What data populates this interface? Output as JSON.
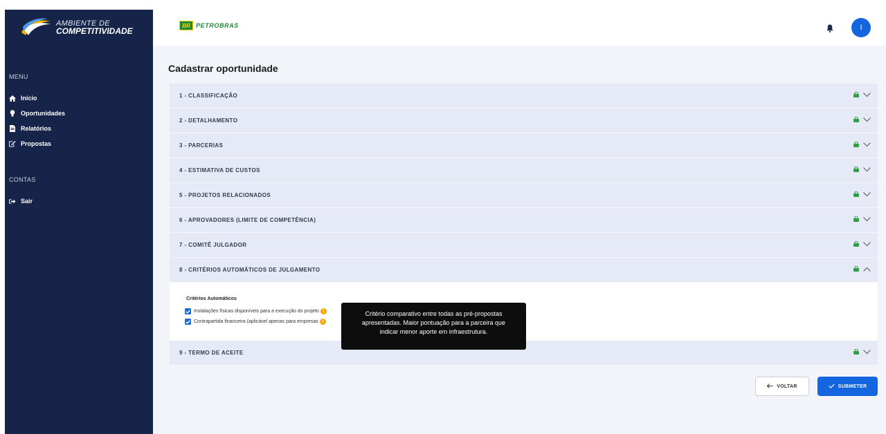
{
  "sidebar": {
    "logo": {
      "line1": "AMBIENTE DE",
      "line2": "COMPETITIVIDADE"
    },
    "menu_heading": "MENU",
    "menu_items": [
      {
        "label": "Início",
        "icon": "home-icon"
      },
      {
        "label": "Oportunidades",
        "icon": "lightbulb-icon"
      },
      {
        "label": "Relatórios",
        "icon": "file-icon"
      },
      {
        "label": "Propostas",
        "icon": "edit-icon"
      }
    ],
    "accounts_heading": "CONTAS",
    "account_items": [
      {
        "label": "Sair",
        "icon": "sign-out-icon"
      }
    ]
  },
  "header": {
    "brand_badge": "BR",
    "brand_name": "PETROBRAS",
    "avatar_initial": "I"
  },
  "main": {
    "title": "Cadastrar oportunidade",
    "sections": [
      {
        "label": "1 - CLASSIFICAÇÃO",
        "expanded": false
      },
      {
        "label": "2 - DETALHAMENTO",
        "expanded": false
      },
      {
        "label": "3 - PARCERIAS",
        "expanded": false
      },
      {
        "label": "4 - ESTIMATIVA DE CUSTOS",
        "expanded": false
      },
      {
        "label": "5 - PROJETOS RELACIONADOS",
        "expanded": false
      },
      {
        "label": "6 - APROVADORES (LIMITE DE COMPETÊNCIA)",
        "expanded": false
      },
      {
        "label": "7 - COMITÊ JULGADOR",
        "expanded": false
      },
      {
        "label": "8 - CRITÉRIOS AUTOMÁTICOS DE JULGAMENTO",
        "expanded": true
      },
      {
        "label": "9 - TERMO DE ACEITE",
        "expanded": false
      }
    ],
    "criteria": {
      "title": "Critérios Automáticos",
      "items": [
        {
          "label": "Instalações físicas disponíveis para a execução do projeto",
          "checked": true
        },
        {
          "label": "Contrapartida financeira (aplicável apenas para empresas",
          "checked": true
        }
      ]
    },
    "tooltip": {
      "line1": "Critério comparativo entre todas as pré-propostas",
      "line2": "apresentadas. Maior pontuação para a parceira que",
      "line3": "indicar menor aporte em infraestrutura."
    },
    "buttons": {
      "back_label": "VOLTAR",
      "submit_label": "SUBMETER"
    }
  },
  "colors": {
    "sidebar_bg": "#17244a",
    "accent": "#1565e0",
    "section_bg": "#e6eaf6",
    "lock_green": "#2f9e44",
    "info_orange": "#f2a70c"
  }
}
